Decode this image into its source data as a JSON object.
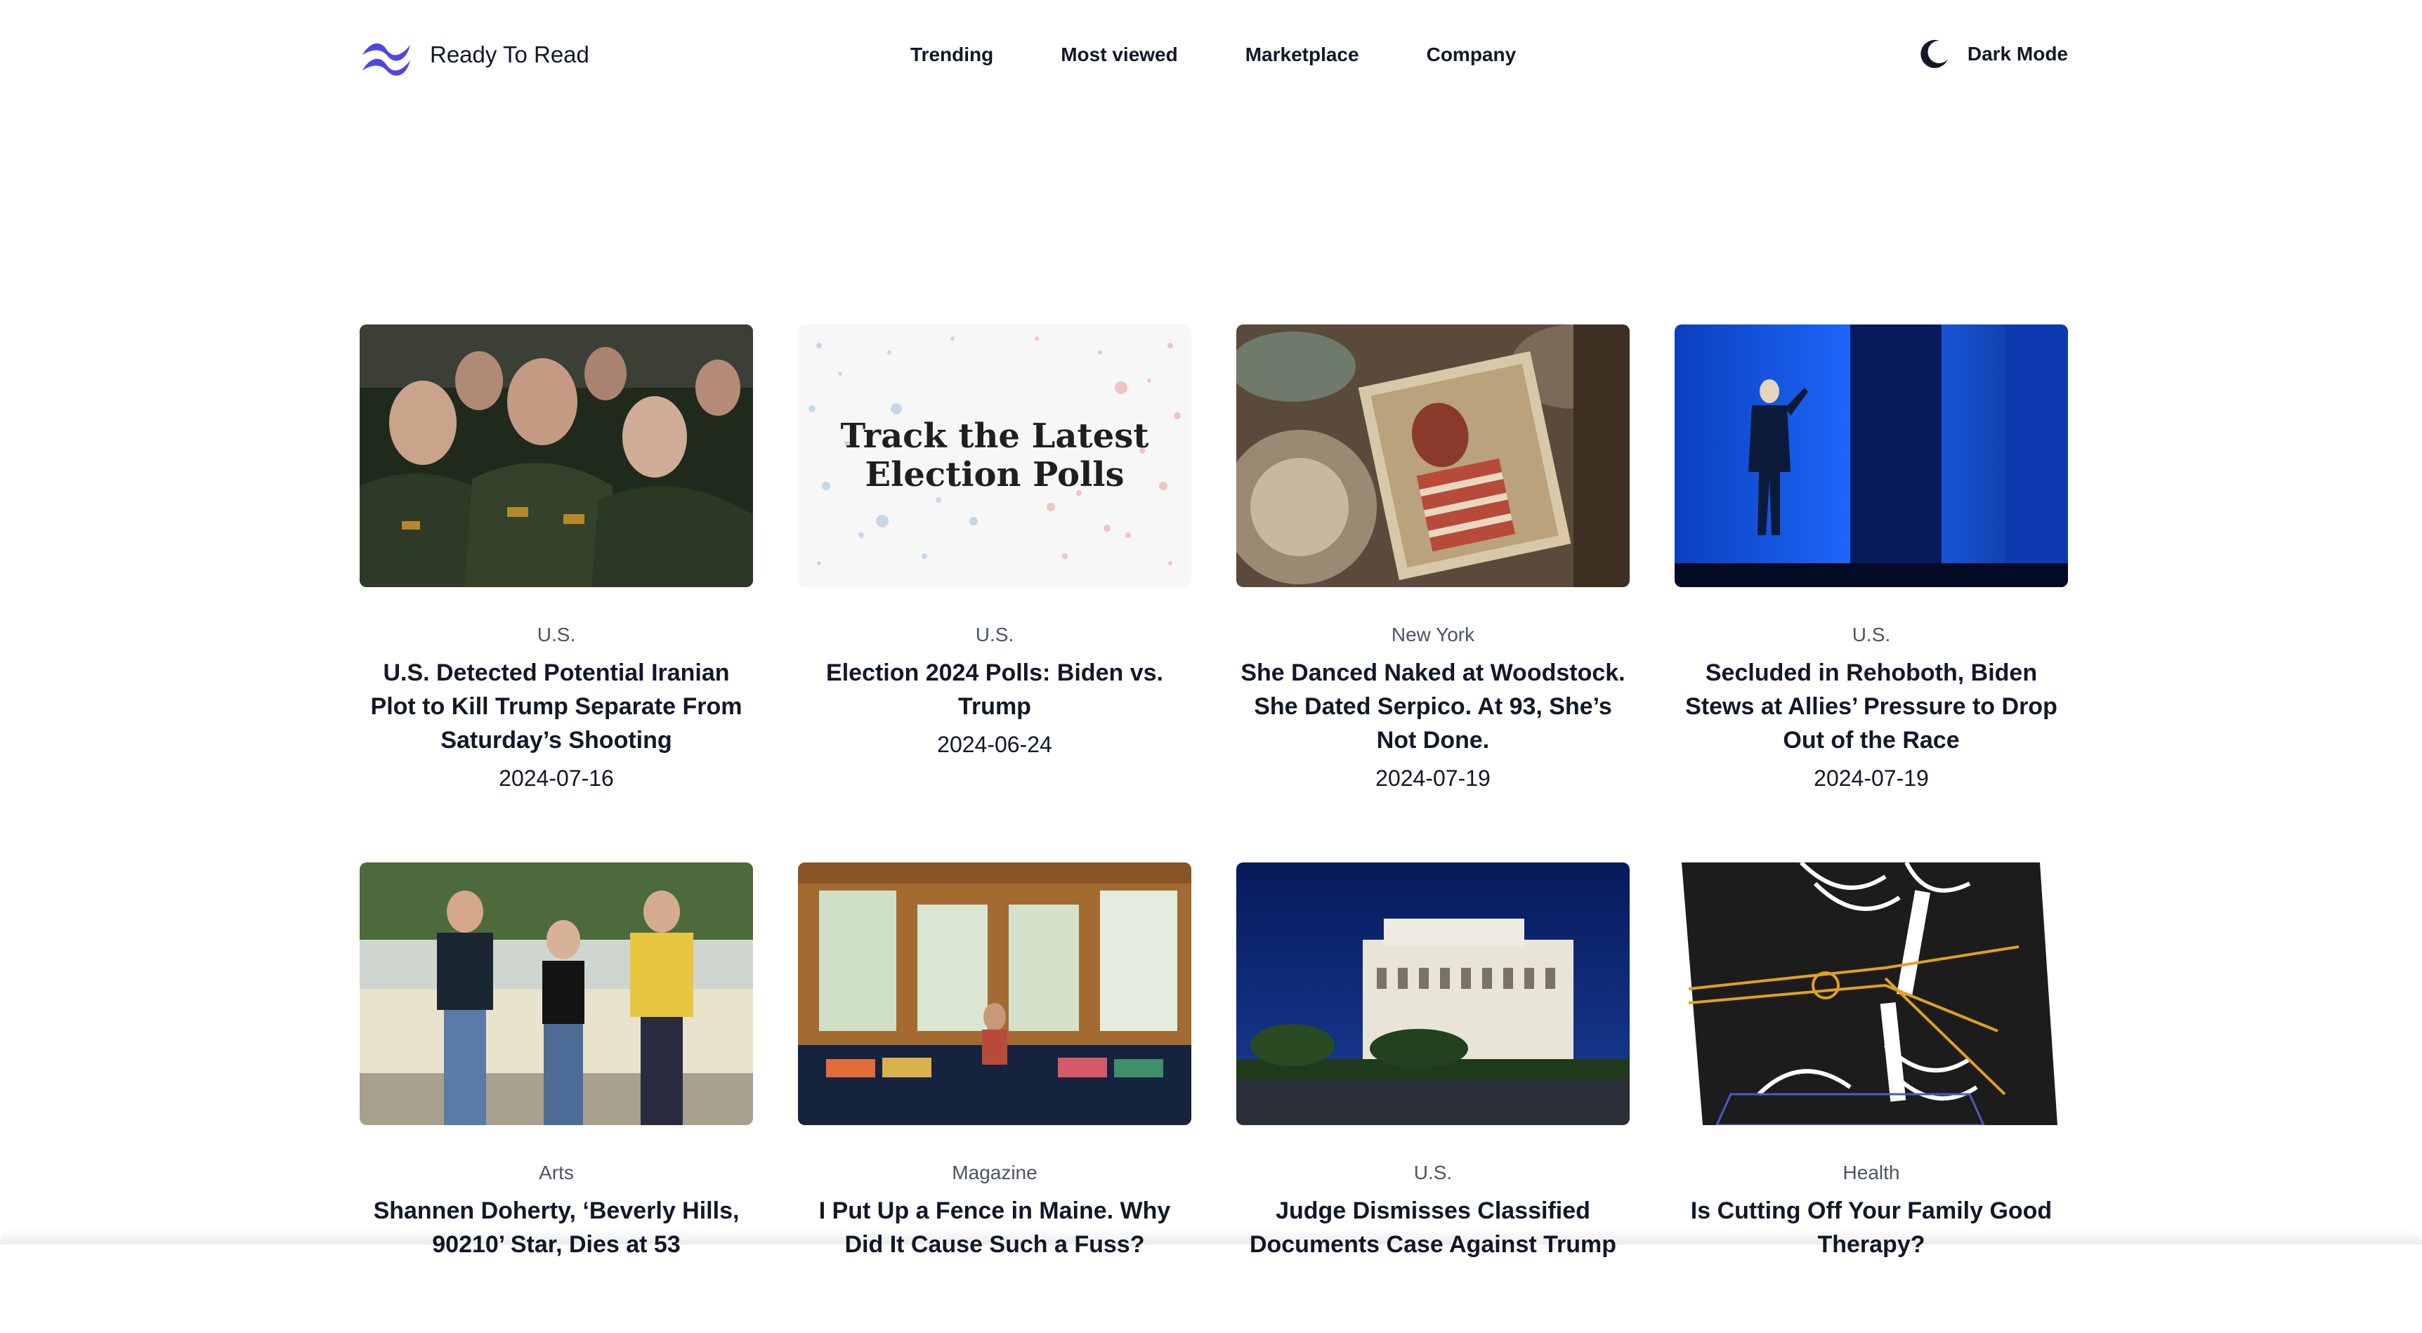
{
  "brand": {
    "name": "Ready To Read",
    "logo_icon": "wave-logo-icon",
    "accent": "#4f46e5"
  },
  "nav": {
    "links": [
      "Trending",
      "Most viewed",
      "Marketplace",
      "Company"
    ]
  },
  "theme_toggle": {
    "label": "Dark Mode",
    "icon": "moon-icon"
  },
  "articles": [
    {
      "category": "U.S.",
      "title": "U.S. Detected Potential Iranian Plot to Kill Trump Separate From Saturday’s Shooting",
      "date": "2024-07-16",
      "image": "military-officers-photo"
    },
    {
      "category": "U.S.",
      "title": "Election 2024 Polls: Biden vs. Trump",
      "date": "2024-06-24",
      "image": "election-polls-graphic",
      "image_text": "Track the Latest Election Polls"
    },
    {
      "category": "New York",
      "title": "She Danced Naked at Woodstock. She Dated Serpico. At 93, She’s Not Done.",
      "date": "2024-07-19",
      "image": "vintage-photo-collage"
    },
    {
      "category": "U.S.",
      "title": "Secluded in Rehoboth, Biden Stews at Allies’ Pressure to Drop Out of the Race",
      "date": "2024-07-19",
      "image": "stage-walk-photo"
    },
    {
      "category": "Arts",
      "title": "Shannen Doherty, ‘Beverly Hills, 90210’ Star, Dies at 53",
      "date": "",
      "image": "three-actors-photo"
    },
    {
      "category": "Magazine",
      "title": "I Put Up a Fence in Maine. Why Did It Cause Such a Fuss?",
      "date": "",
      "image": "sunroom-interior-photo"
    },
    {
      "category": "U.S.",
      "title": "Judge Dismisses Classified Documents Case Against Trump",
      "date": "",
      "image": "courthouse-photo"
    },
    {
      "category": "Health",
      "title": "Is Cutting Off Your Family Good Therapy?",
      "date": "",
      "image": "scissors-illustration"
    }
  ]
}
